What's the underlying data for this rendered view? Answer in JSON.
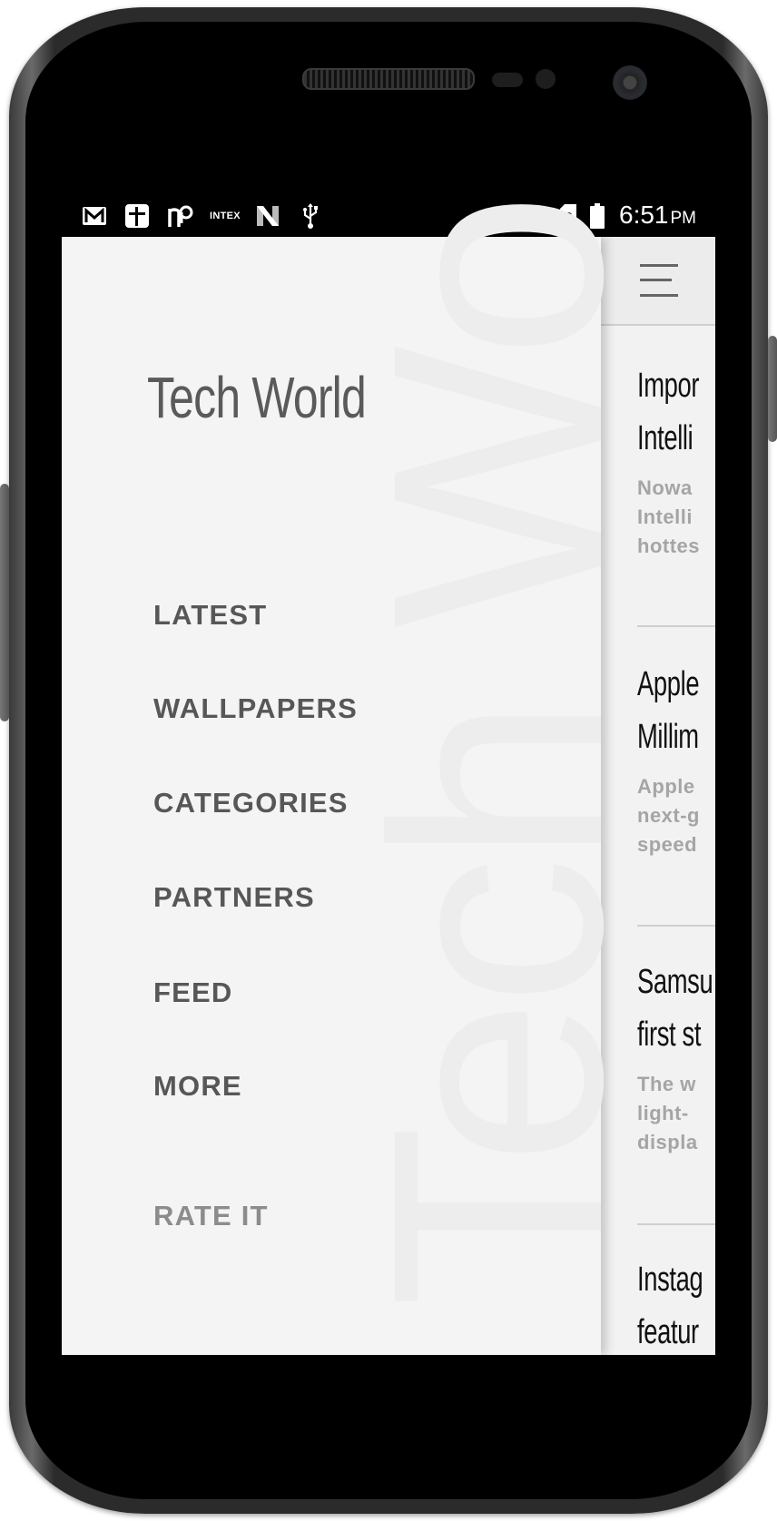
{
  "status_bar": {
    "left_icons": [
      "gmail-icon",
      "plus-app-icon",
      "np-app-icon",
      "intex-icon",
      "n-app-icon",
      "usb-icon"
    ],
    "intex_label": "INTEX",
    "right_icons": [
      "wifi-icon",
      "sim-unknown-icon",
      "battery-icon"
    ],
    "sim_glyph": "?",
    "time": "6:51",
    "ampm": "PM"
  },
  "drawer": {
    "watermark": "Tech World",
    "title": "Tech World",
    "menu": [
      {
        "label": "LATEST"
      },
      {
        "label": "WALLPAPERS"
      },
      {
        "label": "CATEGORIES"
      },
      {
        "label": "PARTNERS"
      },
      {
        "label": "FEED"
      },
      {
        "label": "MORE"
      }
    ],
    "rate_label": "RATE IT"
  },
  "toolbar": {
    "menu_icon": "hamburger-icon"
  },
  "articles": [
    {
      "title_line1": "Impor",
      "title_line2": "Intelli",
      "excerpt": [
        "Nowa",
        "Intelli",
        "hottes"
      ]
    },
    {
      "title_line1": "Apple",
      "title_line2": "Millim",
      "excerpt": [
        "Apple",
        "next-g",
        "speed"
      ]
    },
    {
      "title_line1": "Samsu",
      "title_line2": "first st",
      "excerpt": [
        "The w",
        "light-",
        "displa"
      ]
    },
    {
      "title_line1": "Instag",
      "title_line2": "featur",
      "excerpt": []
    }
  ]
}
